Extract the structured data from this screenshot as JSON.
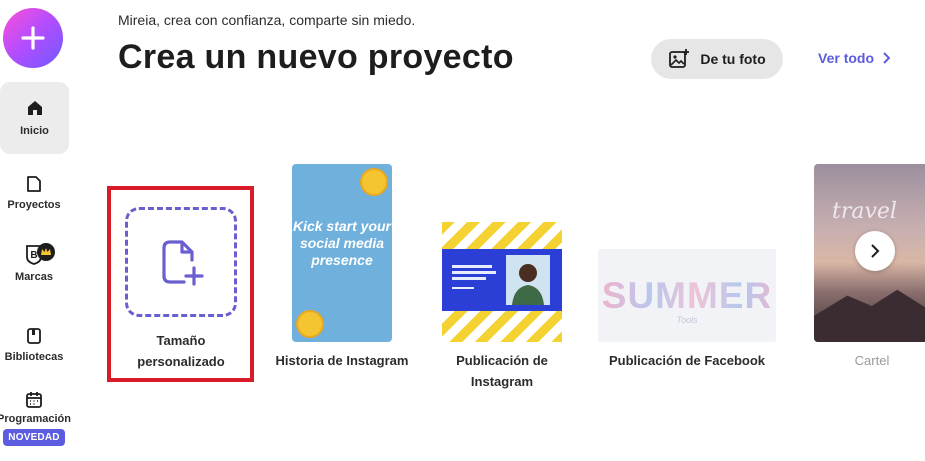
{
  "sidebar": {
    "create_icon": "plus-icon",
    "items": [
      {
        "label": "Inicio",
        "icon": "home-icon"
      },
      {
        "label": "Proyectos",
        "icon": "folder-icon"
      },
      {
        "label": "Marcas",
        "icon": "brand-icon"
      },
      {
        "label": "Bibliotecas",
        "icon": "library-icon"
      },
      {
        "label": "Programación",
        "icon": "calendar-icon",
        "badge": "NOVEDAD"
      }
    ]
  },
  "header": {
    "greeting": "Mireia, crea con confianza, comparte sin miedo.",
    "title": "Crea un nuevo proyecto",
    "photo_button": "De tu foto",
    "see_all": "Ver todo"
  },
  "templates": [
    {
      "label_line1": "Tamaño",
      "label_line2": "personalizado",
      "icon": "add-file-icon"
    },
    {
      "label": "Historia de Instagram",
      "thumb_text": "Kick start your social media presence"
    },
    {
      "label_line1": "Publicación de",
      "label_line2": "Instagram"
    },
    {
      "label": "Publicación de Facebook",
      "thumb_text": "SUMMER",
      "thumb_sub": "Tools"
    },
    {
      "label": "Cartel",
      "thumb_text": "travel"
    }
  ],
  "colors": {
    "accent": "#5c5ce0",
    "highlight": "#d71c28",
    "badge": "#5c5ce0"
  }
}
